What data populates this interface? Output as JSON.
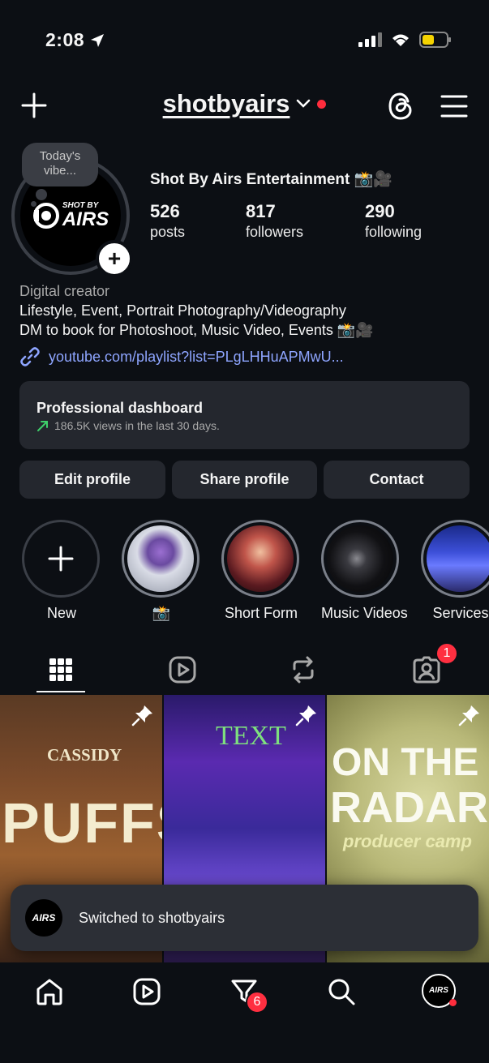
{
  "status": {
    "time": "2:08",
    "battery_color": "#f5d300"
  },
  "header": {
    "username": "shotbyairs"
  },
  "profile": {
    "note": "Today's vibe...",
    "logo_top": "SHOT BY",
    "logo_main": "AIRS",
    "display_name": "Shot By Airs Entertainment 📸🎥",
    "stats": [
      {
        "value": "526",
        "label": "posts"
      },
      {
        "value": "817",
        "label": "followers"
      },
      {
        "value": "290",
        "label": "following"
      }
    ],
    "category": "Digital creator",
    "bio_line1": "Lifestyle, Event, Portrait Photography/Videography",
    "bio_line2": "DM to book for Photoshoot, Music Video, Events 📸🎥",
    "link": "youtube.com/playlist?list=PLgLHHuAPMwU..."
  },
  "dashboard": {
    "title": "Professional dashboard",
    "subtitle": "186.5K views in the last 30 days."
  },
  "buttons": {
    "edit": "Edit profile",
    "share": "Share profile",
    "contact": "Contact"
  },
  "highlights": [
    {
      "label": "New",
      "icon": "plus-icon"
    },
    {
      "label": "📸"
    },
    {
      "label": "Short Form"
    },
    {
      "label": "Music Videos"
    },
    {
      "label": "Services"
    }
  ],
  "tabs": {
    "tagged_badge": "1"
  },
  "grid": [
    {
      "title_small": "CASSIDY",
      "title_big": "PUFFS"
    },
    {
      "title_small": "TEXT",
      "title_big": ""
    },
    {
      "title_small": "ON THE",
      "title_big": "RADAR",
      "subtitle": "producer camp"
    }
  ],
  "toast": {
    "text": "Switched to shotbyairs"
  },
  "nav": {
    "activity_badge": "6"
  }
}
